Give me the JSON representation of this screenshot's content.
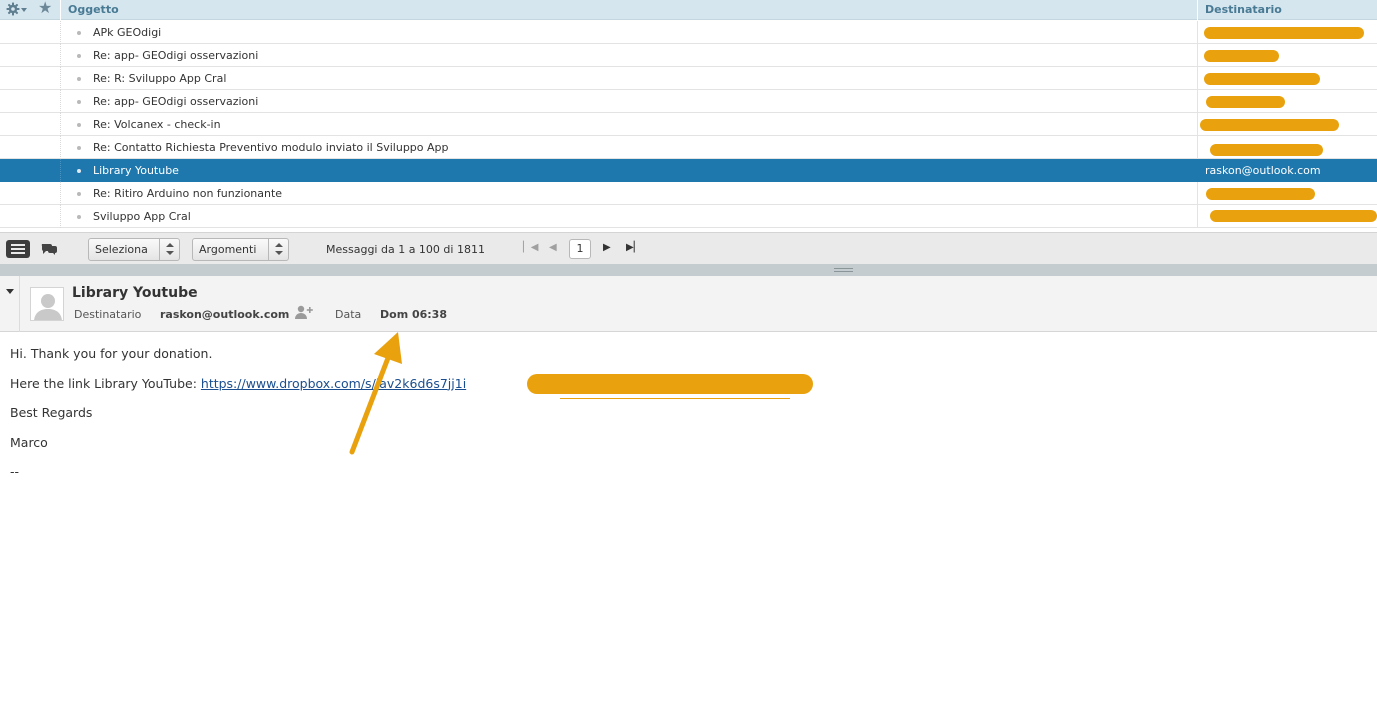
{
  "list": {
    "columns": {
      "subject": "Oggetto",
      "recipient": "Destinatario"
    },
    "rows": [
      {
        "subject": "APk GEOdigi",
        "recipient": "",
        "selected": false
      },
      {
        "subject": "Re: app- GEOdigi osservazioni",
        "recipient": "",
        "selected": false
      },
      {
        "subject": "Re: R: Sviluppo App Cral",
        "recipient": "",
        "selected": false
      },
      {
        "subject": "Re: app- GEOdigi osservazioni",
        "recipient": "",
        "selected": false
      },
      {
        "subject": "Re: Volcanex - check-in",
        "recipient": "",
        "selected": false
      },
      {
        "subject": "Re: Contatto Richiesta Preventivo modulo inviato il Sviluppo App",
        "recipient": "",
        "selected": false
      },
      {
        "subject": "Library Youtube",
        "recipient": "raskon@outlook.com",
        "selected": true
      },
      {
        "subject": "Re: Ritiro Arduino non funzionante",
        "recipient": "",
        "selected": false
      },
      {
        "subject": "Sviluppo App Cral",
        "recipient": "",
        "selected": false
      }
    ]
  },
  "toolbar": {
    "select_label": "Seleziona",
    "threads_label": "Argomenti",
    "count_text": "Messaggi da 1 a 100 di 1811",
    "page": "1"
  },
  "message": {
    "title": "Library Youtube",
    "to_label": "Destinatario",
    "to_value": "raskon@outlook.com",
    "date_label": "Data",
    "date_value": "Dom 06:38",
    "body": {
      "line1": "Hi. Thank you for your donation.",
      "line2_prefix": "Here the link Library YouTube: ",
      "link": "https://www.dropbox.com/s/iav2k6d6s7jj1i",
      "line3": "Best Regards",
      "line4": "Marco",
      "signature_sep": "--"
    }
  },
  "colors": {
    "header_bg": "#d5e6ef",
    "selected_row": "#1f78ad",
    "redaction": "#e9a20e"
  },
  "icons": [
    "gear-icon",
    "star-icon",
    "list-view-icon",
    "thread-view-icon",
    "first-page-icon",
    "prev-page-icon",
    "next-page-icon",
    "last-page-icon",
    "avatar-icon",
    "add-contact-icon",
    "arrow-annotation"
  ]
}
